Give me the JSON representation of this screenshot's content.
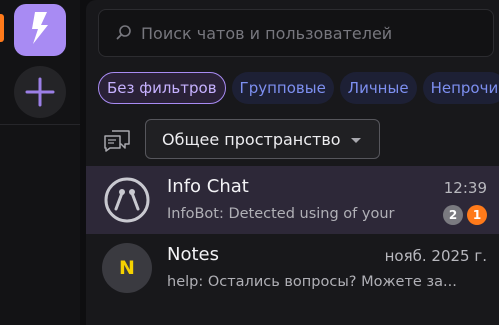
{
  "colors": {
    "accent": "#a88bf3",
    "unread_orange": "#ff7a1a",
    "chip_text": "#7d8ff0"
  },
  "sidebar": {
    "workspace_icon": "lightning-bolt-icon",
    "add_icon": "plus-icon"
  },
  "search": {
    "placeholder": "Поиск чатов и пользователей",
    "icon": "search-icon"
  },
  "filters": [
    {
      "label": "Без фильтров",
      "active": true
    },
    {
      "label": "Групповые",
      "active": false
    },
    {
      "label": "Личные",
      "active": false
    },
    {
      "label": "Непрочи",
      "active": false
    }
  ],
  "workspace_selector": {
    "icon": "chat-bubbles-icon",
    "value": "Общее пространство"
  },
  "chats": [
    {
      "title": "Info Chat",
      "time": "12:39",
      "preview": "InfoBot: Detected using of your",
      "badge_mentions": "2",
      "badge_unread": "1",
      "avatar_icon": "bot-face-icon"
    },
    {
      "title": "Notes",
      "time": "нояб. 2025 г.",
      "preview": "help: Остались вопросы? Можете за...",
      "avatar_initial": "N"
    }
  ]
}
